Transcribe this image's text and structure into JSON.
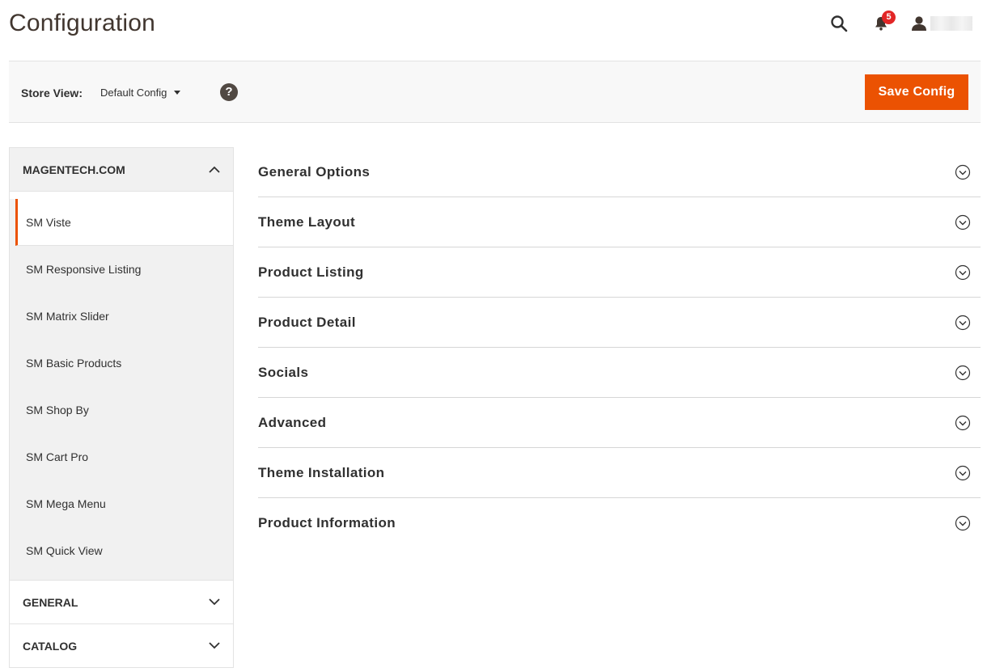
{
  "header": {
    "title": "Configuration",
    "notification_count": "5"
  },
  "store_bar": {
    "label": "Store View:",
    "selected_scope": "Default Config",
    "help_symbol": "?",
    "save_label": "Save Config"
  },
  "sidebar": {
    "sections": [
      {
        "label": "MAGENTECH.COM",
        "expanded": true,
        "items": [
          {
            "label": "SM Viste",
            "active": true
          },
          {
            "label": "SM Responsive Listing"
          },
          {
            "label": "SM Matrix Slider"
          },
          {
            "label": "SM Basic Products"
          },
          {
            "label": "SM Shop By"
          },
          {
            "label": "SM Cart Pro"
          },
          {
            "label": "SM Mega Menu"
          },
          {
            "label": "SM Quick View"
          }
        ]
      },
      {
        "label": "GENERAL",
        "expanded": false
      },
      {
        "label": "CATALOG",
        "expanded": false
      }
    ]
  },
  "main": {
    "groups": [
      {
        "label": "General Options"
      },
      {
        "label": "Theme Layout"
      },
      {
        "label": "Product Listing"
      },
      {
        "label": "Product Detail"
      },
      {
        "label": "Socials"
      },
      {
        "label": "Advanced"
      },
      {
        "label": "Theme Installation"
      },
      {
        "label": "Product Information"
      }
    ]
  },
  "icons": {
    "search": "search-icon",
    "notifications": "bell-icon",
    "user": "user-icon",
    "help": "help-icon",
    "section_open": "chevron-up-icon",
    "section_closed": "chevron-down-icon",
    "group_toggle": "circle-chevron-down-icon"
  },
  "colors": {
    "accent": "#eb5202",
    "badge": "#e22626",
    "panel_bg": "#f1f1f1",
    "title": "#41362f"
  }
}
